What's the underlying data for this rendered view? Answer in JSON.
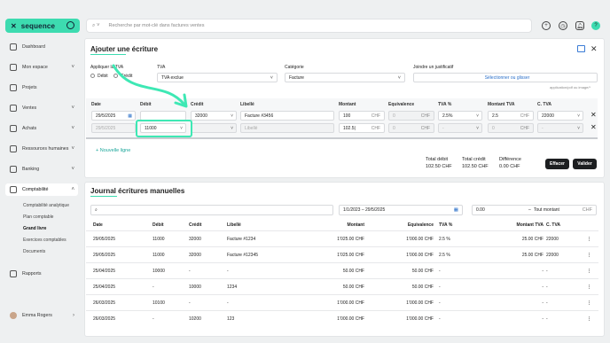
{
  "app": {
    "logo": "sequence",
    "search_placeholder": "Recherche par mot-clé dans factures ventes"
  },
  "sidebar": {
    "items": [
      {
        "label": "Dashboard"
      },
      {
        "label": "Mon espace"
      },
      {
        "label": "Projets"
      },
      {
        "label": "Ventes"
      },
      {
        "label": "Achats"
      },
      {
        "label": "Ressources humaines"
      },
      {
        "label": "Banking"
      },
      {
        "label": "Comptabilité"
      },
      {
        "label": "Rapports"
      }
    ],
    "subitems": [
      "Comptabilité analytique",
      "Plan comptable",
      "Grand livre",
      "Exercices comptables",
      "Documents"
    ],
    "user": "Emma Rogers"
  },
  "entry": {
    "title": "Ajouter une écriture",
    "apply_label": "Appliquer la TVA",
    "debit_radio": "Débit",
    "credit_radio": "Crédit",
    "tva_label": "TVA",
    "tva_value": "TVA exclue",
    "category_label": "Catégorie",
    "category_value": "Facture",
    "attach_label": "Joindre un justificatif",
    "attach_button": "Sélectionner ou glisser",
    "attach_hint": "application/pdf ou image/*",
    "headers": {
      "date": "Date",
      "debit": "Débit",
      "credit": "Crédit",
      "libelle": "Libellé",
      "montant": "Montant",
      "equivalence": "Equivalence",
      "tva_pct": "TVA %",
      "montant_tva": "Montant TVA",
      "c_tva": "C. TVA"
    },
    "row1": {
      "date": "29/5/2025",
      "debit": "",
      "credit": "32000",
      "libelle": "Facture #3456",
      "montant": "100",
      "montant_unit": "CHF",
      "equivalence": "0",
      "equiv_unit": "CHF",
      "tva_pct": "2.5%",
      "montant_tva": "2.5",
      "tva_unit": "CHF",
      "c_tva": "22000"
    },
    "row2": {
      "date": "29/5/2025",
      "debit": "11000",
      "credit": "",
      "libelle": "Libellé",
      "montant": "102.5|",
      "montant_unit": "CHF",
      "equivalence": "0",
      "equiv_unit": "CHF",
      "tva_pct": "-",
      "montant_tva": "0",
      "tva_unit": "CHF",
      "c_tva": "-"
    },
    "new_line": "Nouvelle ligne",
    "totals": {
      "debit_label": "Total débit",
      "debit_value": "102.50 CHF",
      "credit_label": "Total crédit",
      "credit_value": "102.50 CHF",
      "diff_label": "Différence",
      "diff_value": "0.00 CHF"
    },
    "clear_button": "Effacer",
    "validate_button": "Valider"
  },
  "journal": {
    "title": "Journal écritures manuelles",
    "date_range": "1/1/2023 – 29/5/2025",
    "amount_from": "0.00",
    "amount_to": "Tout montant",
    "amount_unit": "CHF",
    "headers": {
      "date": "Date",
      "debit": "Débit",
      "credit": "Crédit",
      "libelle": "Libellé",
      "montant": "Montant",
      "equivalence": "Equivalence",
      "tva_pct": "TVA %",
      "montant_tva": "Montant TVA",
      "c_tva": "C. TVA"
    },
    "rows": [
      {
        "date": "29/05/2025",
        "debit": "11000",
        "credit": "32000",
        "libelle": "Facture #1234",
        "montant": "1'025.00 CHF",
        "equivalence": "1'000.00 CHF",
        "tva_pct": "2.5 %",
        "montant_tva": "25.00 CHF",
        "c_tva": "22000"
      },
      {
        "date": "29/05/2025",
        "debit": "11000",
        "credit": "32000",
        "libelle": "Facture #12345",
        "montant": "1'025.00 CHF",
        "equivalence": "1'000.00 CHF",
        "tva_pct": "2.5 %",
        "montant_tva": "25.00 CHF",
        "c_tva": "22000"
      },
      {
        "date": "25/04/2025",
        "debit": "10000",
        "credit": "-",
        "libelle": "-",
        "montant": "50.00 CHF",
        "equivalence": "50.00 CHF",
        "tva_pct": "-",
        "montant_tva": "-",
        "c_tva": "-"
      },
      {
        "date": "25/04/2025",
        "debit": "-",
        "credit": "10000",
        "libelle": "1234",
        "montant": "50.00 CHF",
        "equivalence": "50.00 CHF",
        "tva_pct": "-",
        "montant_tva": "-",
        "c_tva": "-"
      },
      {
        "date": "26/03/2025",
        "debit": "10100",
        "credit": "-",
        "libelle": "-",
        "montant": "1'000.00 CHF",
        "equivalence": "1'000.00 CHF",
        "tva_pct": "-",
        "montant_tva": "-",
        "c_tva": "-"
      },
      {
        "date": "26/03/2025",
        "debit": "-",
        "credit": "10200",
        "libelle": "123",
        "montant": "1'000.00 CHF",
        "equivalence": "1'000.00 CHF",
        "tva_pct": "-",
        "montant_tva": "-",
        "c_tva": "-"
      }
    ]
  },
  "colors": {
    "accent": "#3ddbb0",
    "highlight": "#3ee8b4"
  }
}
